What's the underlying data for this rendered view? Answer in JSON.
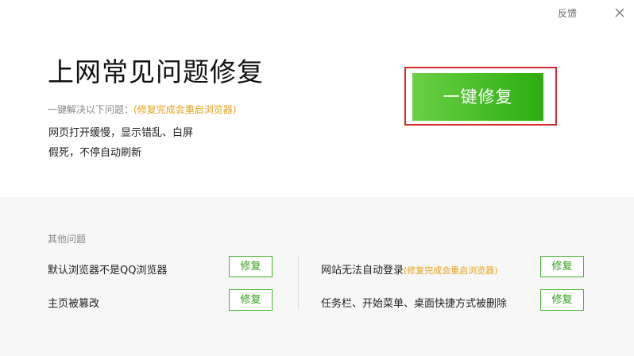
{
  "window": {
    "feedback_label": "反馈",
    "close_icon": "close-icon"
  },
  "hero": {
    "title": "上网常见问题修复",
    "subtitle_prefix": "一键解决以下问题：",
    "subtitle_note": "(修复完成会重启浏览器)",
    "issues": [
      "网页打开缓慢，显示错乱、白屏",
      "假死，不停自动刷新"
    ],
    "fix_button_label": "一键修复"
  },
  "other": {
    "section_label": "其他问题",
    "fix_label": "修复",
    "items": [
      {
        "text": "默认浏览器不是QQ浏览器",
        "note": ""
      },
      {
        "text": "主页被篡改",
        "note": ""
      },
      {
        "text": "网站无法自动登录",
        "note": "(修复完成会重启浏览器)"
      },
      {
        "text": "任务栏、开始菜单、桌面快捷方式被删除",
        "note": ""
      }
    ]
  },
  "colors": {
    "accent_green": "#2cad10",
    "highlight_red": "#d22a2a",
    "note_orange": "#e6a21a"
  }
}
